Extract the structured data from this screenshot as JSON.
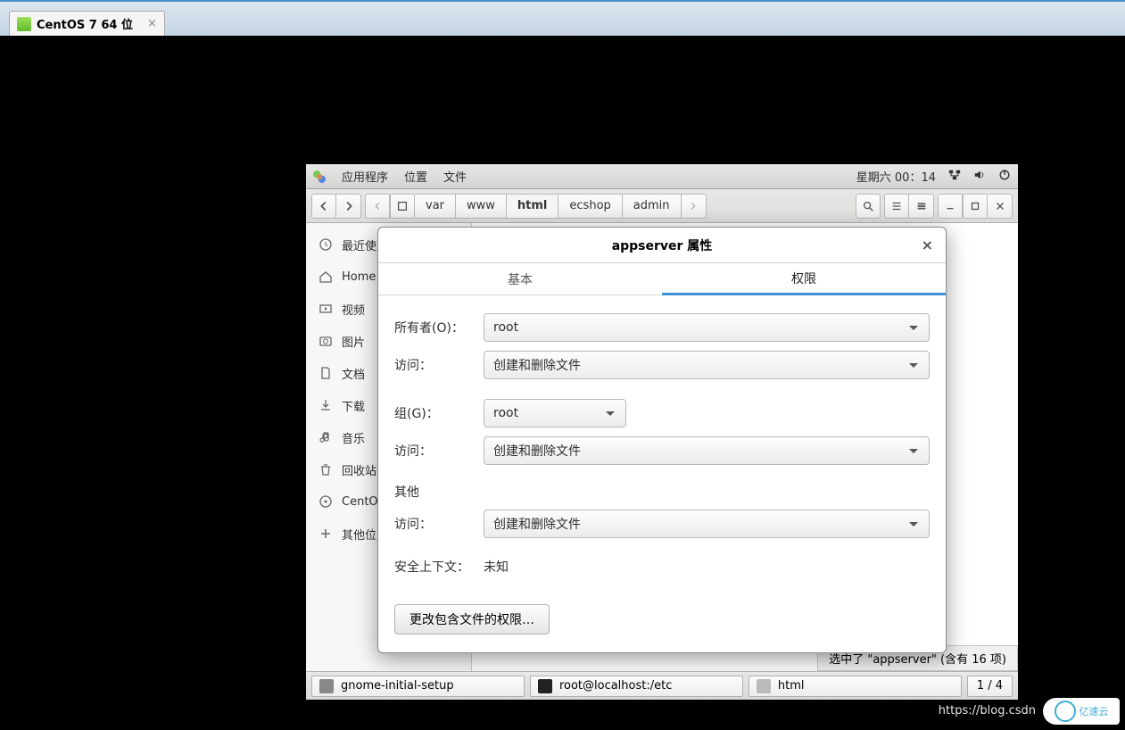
{
  "vm_tab": {
    "title": "CentOS 7 64 位"
  },
  "gnome": {
    "menu": [
      "应用程序",
      "位置",
      "文件"
    ],
    "clock": "星期六 00：14"
  },
  "fm": {
    "path": [
      "var",
      "www",
      "html",
      "ecshop",
      "admin"
    ],
    "path_active_index": 2,
    "sidebar": [
      {
        "icon": "clock",
        "label": "最近使用"
      },
      {
        "icon": "home",
        "label": "Home"
      },
      {
        "icon": "video",
        "label": "视频"
      },
      {
        "icon": "camera",
        "label": "图片"
      },
      {
        "icon": "doc",
        "label": "文档"
      },
      {
        "icon": "download",
        "label": "下载"
      },
      {
        "icon": "music",
        "label": "音乐"
      },
      {
        "icon": "trash",
        "label": "回收站"
      },
      {
        "icon": "disc",
        "label": "CentOS"
      },
      {
        "icon": "plus",
        "label": "其他位置"
      }
    ],
    "status": "选中了 \"appserver\"  (含有 16 项)"
  },
  "dialog": {
    "title": "appserver 属性",
    "tabs": {
      "basic": "基本",
      "perm": "权限"
    },
    "labels": {
      "owner": "所有者(O)：",
      "access": "访问：",
      "group": "组(G)：",
      "others": "其他",
      "security": "安全上下文：",
      "security_val": "未知",
      "btn": "更改包含文件的权限…"
    },
    "values": {
      "owner": "root",
      "owner_access": "创建和删除文件",
      "group": "root",
      "group_access": "创建和删除文件",
      "other_access": "创建和删除文件"
    }
  },
  "taskbar": {
    "items": [
      {
        "icon": "wrench",
        "label": "gnome-initial-setup"
      },
      {
        "icon": "term",
        "label": "root@localhost:/etc"
      },
      {
        "icon": "folder",
        "label": "html"
      }
    ],
    "workspace": "1 / 4"
  },
  "watermark": {
    "url": "https://blog.csdn",
    "logo": "亿速云"
  }
}
